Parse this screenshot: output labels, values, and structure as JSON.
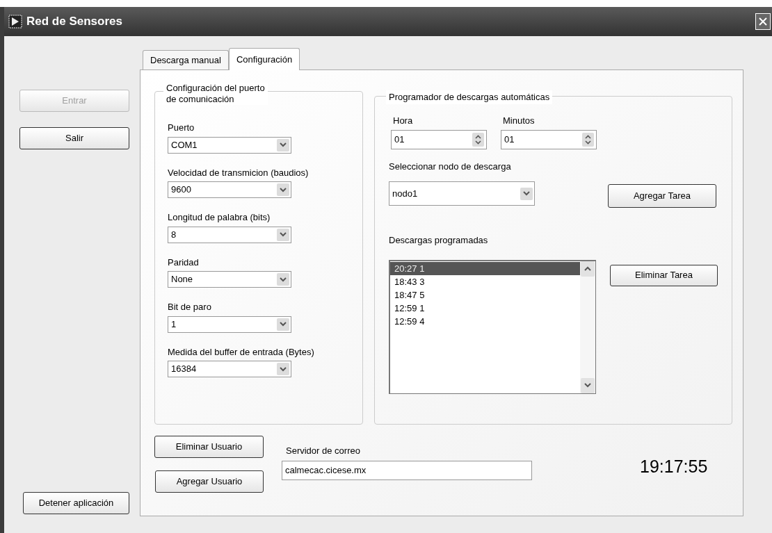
{
  "window": {
    "title": "Red de Sensores"
  },
  "side_buttons": [
    {
      "label": "Entrar",
      "disabled": true
    },
    {
      "label": "Salir",
      "disabled": false
    }
  ],
  "stop_button": "Detener aplicación",
  "tabs": [
    {
      "label": "Descarga manual",
      "selected": false
    },
    {
      "label": "Configuración",
      "selected": true
    }
  ],
  "port_group": {
    "title": "Configuración del puerto\nde comunicación",
    "fields": [
      {
        "label": "Puerto",
        "value": "COM1"
      },
      {
        "label": "Velocidad de transmicion (baudios)",
        "value": "9600"
      },
      {
        "label": "Longitud de palabra  (bits)",
        "value": "8"
      },
      {
        "label": "Paridad",
        "value": "None"
      },
      {
        "label": "Bit de paro",
        "value": "1"
      },
      {
        "label": "Medida del buffer de entrada (Bytes)",
        "value": "16384"
      }
    ]
  },
  "scheduler": {
    "title": "Programador de descargas automáticas",
    "spinners": [
      {
        "label": "Hora",
        "value": "01"
      },
      {
        "label": "Minutos",
        "value": "01"
      }
    ],
    "node_label": "Seleccionar nodo de descarga",
    "node_value": "nodo1",
    "add_button": "Agregar Tarea",
    "list_label": "Descargas programadas",
    "list": [
      {
        "text": "20:27 1",
        "selected": true
      },
      {
        "text": "18:43 3",
        "selected": false
      },
      {
        "text": "18:47 5",
        "selected": false
      },
      {
        "text": "12:59 1",
        "selected": false
      },
      {
        "text": "12:59 4",
        "selected": false
      }
    ],
    "remove_button": "Eliminar Tarea"
  },
  "bottom": {
    "delete_user": "Eliminar Usuario",
    "add_user": "Agregar Usuario",
    "mail_label": "Servidor de correo",
    "mail_value": "calmecac.cicese.mx",
    "clock": "19:17:55"
  }
}
